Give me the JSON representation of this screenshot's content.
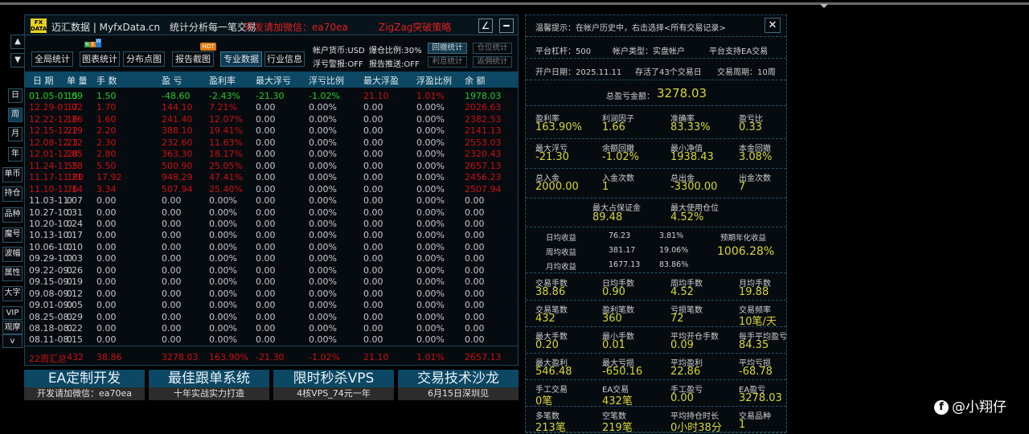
{
  "title": {
    "brand": "迈汇数据 | MyfxData.cn",
    "slogan": "统计分析每一笔交易",
    "contact": "开发请加微信：ea70ea",
    "strategy": "ZigZag突破策略",
    "logo": "FX DATA",
    "edit_icon": "∠",
    "min_icon": "━"
  },
  "toolbar": {
    "buttons": [
      "全局统计",
      "图表统计",
      "分布点图",
      "报告截图",
      "专业数据",
      "行业信息"
    ],
    "selected": 4,
    "new_badge": [
      "N",
      "E",
      "W"
    ],
    "hot_badge": "HOT",
    "currency": "帐户货币:USD",
    "position_ratio": "爆仓比例:30%",
    "float_alert": "浮亏警报:OFF",
    "report_push": "报告推送:OFF",
    "small_buttons": [
      "回撤统计",
      "仓位统计",
      "利息统计",
      "返佣统计"
    ]
  },
  "columns": [
    "日 期",
    "单 量",
    "手 数",
    "盈 亏",
    "盈利率",
    "最大浮亏",
    "浮亏比例",
    "最大浮盈",
    "浮盈比例",
    "余 额"
  ],
  "rows": [
    [
      "01.05-01.09",
      "15",
      "1.50",
      "-48.60",
      "-2.43%",
      "-21.30",
      "-1.02%",
      "21.10",
      "1.01%",
      "1978.03"
    ],
    [
      "12.29-01.02",
      "17",
      "1.70",
      "144.10",
      "7.21%",
      "0.00",
      "0.00%",
      "0.00",
      "0.00%",
      "2026.63"
    ],
    [
      "12.22-12.26",
      "16",
      "1.60",
      "241.40",
      "12.07%",
      "0.00",
      "0.00%",
      "0.00",
      "0.00%",
      "2382.53"
    ],
    [
      "12.15-12.19",
      "22",
      "2.20",
      "388.10",
      "19.41%",
      "0.00",
      "0.00%",
      "0.00",
      "0.00%",
      "2141.13"
    ],
    [
      "12.08-12.12",
      "23",
      "2.30",
      "232.60",
      "11.63%",
      "0.00",
      "0.00%",
      "0.00",
      "0.00%",
      "2553.03"
    ],
    [
      "12.01-12.05",
      "28",
      "2.80",
      "363.30",
      "18.17%",
      "0.00",
      "0.00%",
      "0.00",
      "0.00%",
      "2320.43"
    ],
    [
      "11.24-11.28",
      "55",
      "5.50",
      "500.90",
      "25.05%",
      "0.00",
      "0.00%",
      "0.00",
      "0.00%",
      "2657.13"
    ],
    [
      "11.17-11.21",
      "180",
      "17.92",
      "948.29",
      "47.41%",
      "0.00",
      "0.00%",
      "0.00",
      "0.00%",
      "2456.23"
    ],
    [
      "11.10-11.14",
      "76",
      "3.34",
      "507.94",
      "25.40%",
      "0.00",
      "0.00%",
      "0.00",
      "0.00%",
      "2507.94"
    ],
    [
      "11.03-11.07",
      "0",
      "0.00",
      "0.00",
      "0.00%",
      "0.00",
      "0.00%",
      "0.00",
      "0.00%",
      "0.00"
    ],
    [
      "10.27-10.31",
      "0",
      "0.00",
      "0.00",
      "0.00%",
      "0.00",
      "0.00%",
      "0.00",
      "0.00%",
      "0.00"
    ],
    [
      "10.20-10.24",
      "0",
      "0.00",
      "0.00",
      "0.00%",
      "0.00",
      "0.00%",
      "0.00",
      "0.00%",
      "0.00"
    ],
    [
      "10.13-10.17",
      "0",
      "0.00",
      "0.00",
      "0.00%",
      "0.00",
      "0.00%",
      "0.00",
      "0.00%",
      "0.00"
    ],
    [
      "10.06-10.10",
      "0",
      "0.00",
      "0.00",
      "0.00%",
      "0.00",
      "0.00%",
      "0.00",
      "0.00%",
      "0.00"
    ],
    [
      "09.29-10.03",
      "0",
      "0.00",
      "0.00",
      "0.00%",
      "0.00",
      "0.00%",
      "0.00",
      "0.00%",
      "0.00"
    ],
    [
      "09.22-09.26",
      "0",
      "0.00",
      "0.00",
      "0.00%",
      "0.00",
      "0.00%",
      "0.00",
      "0.00%",
      "0.00"
    ],
    [
      "09.15-09.19",
      "0",
      "0.00",
      "0.00",
      "0.00%",
      "0.00",
      "0.00%",
      "0.00",
      "0.00%",
      "0.00"
    ],
    [
      "09.08-09.12",
      "0",
      "0.00",
      "0.00",
      "0.00%",
      "0.00",
      "0.00%",
      "0.00",
      "0.00%",
      "0.00"
    ],
    [
      "09.01-09.05",
      "0",
      "0.00",
      "0.00",
      "0.00%",
      "0.00",
      "0.00%",
      "0.00",
      "0.00%",
      "0.00"
    ],
    [
      "08.25-08.29",
      "0",
      "0.00",
      "0.00",
      "0.00%",
      "0.00",
      "0.00%",
      "0.00",
      "0.00%",
      "0.00"
    ],
    [
      "08.18-08.22",
      "0",
      "0.00",
      "0.00",
      "0.00%",
      "0.00",
      "0.00%",
      "0.00",
      "0.00%",
      "0.00"
    ],
    [
      "08.11-08.15",
      "0",
      "0.00",
      "0.00",
      "0.00%",
      "0.00",
      "0.00%",
      "0.00",
      "0.00%",
      "0.00"
    ]
  ],
  "summary": [
    "22周汇总",
    "432",
    "38.86",
    "3278.03",
    "163.90%",
    "-21.30",
    "-1.02%",
    "21.10",
    "1.01%",
    "2657.13"
  ],
  "colors": {
    "loss": "#22cc22",
    "profit": "#cc1010",
    "neutral": "#c8c8c8",
    "value": "#d8d830",
    "header": "#0c4863"
  },
  "side": {
    "up": "▲",
    "down": "▼",
    "periods": [
      "日",
      "周",
      "月",
      "年"
    ],
    "selected_period": 1,
    "tools": [
      "单币",
      "持仓",
      "品种",
      "魔号",
      "波幅",
      "属性",
      "大字",
      "VIP",
      "观摩",
      "v"
    ]
  },
  "banners": [
    {
      "title": "EA定制开发",
      "sub": "开发请加微信：ea70ea"
    },
    {
      "title": "最佳跟单系统",
      "sub": "十年实战实力打造"
    },
    {
      "title": "限时秒杀VPS",
      "sub": "4核VPS_74元一年"
    },
    {
      "title": "交易技术沙龙",
      "sub": "6月15日深圳见"
    }
  ],
  "panel": {
    "tip": "温馨提示：在帐户历史中，右击选择<所有交易记录>",
    "close": "✕",
    "leverage": "平台杠杆：500",
    "account_type": "帐户类型：实盘帐户",
    "ea_support": "平台支持EA交易",
    "open_date": "开户日期：2025.11.11",
    "alive": "存活了43个交易日",
    "period": "交易周期：10周",
    "total_label": "总盈亏金额：",
    "total_value": "3278.03",
    "grid1": [
      {
        "l": "盈利率",
        "v": "163.90%"
      },
      {
        "l": "利润因子",
        "v": "1.66"
      },
      {
        "l": "准确率",
        "v": "83.33%"
      },
      {
        "l": "盈亏比",
        "v": "0.33"
      },
      {
        "l": "最大浮亏",
        "v": "-21.30"
      },
      {
        "l": "余额回撤",
        "v": "-1.02%"
      },
      {
        "l": "最小净值",
        "v": "1938.43"
      },
      {
        "l": "本金回撤",
        "v": "3.08%"
      },
      {
        "l": "总入金",
        "v": "2000.00"
      },
      {
        "l": "入金次数",
        "v": "1"
      },
      {
        "l": "总出金",
        "v": "-3300.00"
      },
      {
        "l": "出金次数",
        "v": "7"
      }
    ],
    "margin": [
      {
        "l": "最大占保证金",
        "v": "89.48"
      },
      {
        "l": "最大使用仓位",
        "v": "4.52%"
      }
    ],
    "avg": [
      {
        "l": "日均收益",
        "a": "76.23",
        "p": "3.81%"
      },
      {
        "l": "周均收益",
        "a": "381.17",
        "p": "19.06%"
      },
      {
        "l": "月均收益",
        "a": "1677.13",
        "p": "83.86%"
      }
    ],
    "annual_label": "预期年化收益",
    "annual_value": "1006.28%",
    "grid2": [
      {
        "l": "交易手数",
        "v": "38.86"
      },
      {
        "l": "日均手数",
        "v": "0.90"
      },
      {
        "l": "周均手数",
        "v": "4.52"
      },
      {
        "l": "月均手数",
        "v": "19.88"
      },
      {
        "l": "交易笔数",
        "v": "432"
      },
      {
        "l": "盈利笔数",
        "v": "360"
      },
      {
        "l": "亏损笔数",
        "v": "72"
      },
      {
        "l": "交易频率",
        "v": "10笔/天"
      },
      {
        "l": "最大手数",
        "v": "0.20"
      },
      {
        "l": "最小手数",
        "v": "0.01"
      },
      {
        "l": "平均开仓手数",
        "v": "0.09"
      },
      {
        "l": "每手平均盈亏",
        "v": "84.35"
      },
      {
        "l": "最大盈利",
        "v": "546.48"
      },
      {
        "l": "最大亏损",
        "v": "-650.16"
      },
      {
        "l": "平均盈利",
        "v": "22.86"
      },
      {
        "l": "平均亏损",
        "v": "-68.78"
      },
      {
        "l": "手工交易",
        "v": "0笔"
      },
      {
        "l": "EA交易",
        "v": "432笔"
      },
      {
        "l": "手工盈亏",
        "v": "0.00"
      },
      {
        "l": "EA盈亏",
        "v": "3278.03"
      },
      {
        "l": "多笔数",
        "v": "213笔"
      },
      {
        "l": "空笔数",
        "v": "219笔"
      },
      {
        "l": "平均持仓时长",
        "v": "0小时38分"
      },
      {
        "l": "交易品种",
        "v": "1"
      }
    ]
  },
  "watermark": "@小翔仔"
}
